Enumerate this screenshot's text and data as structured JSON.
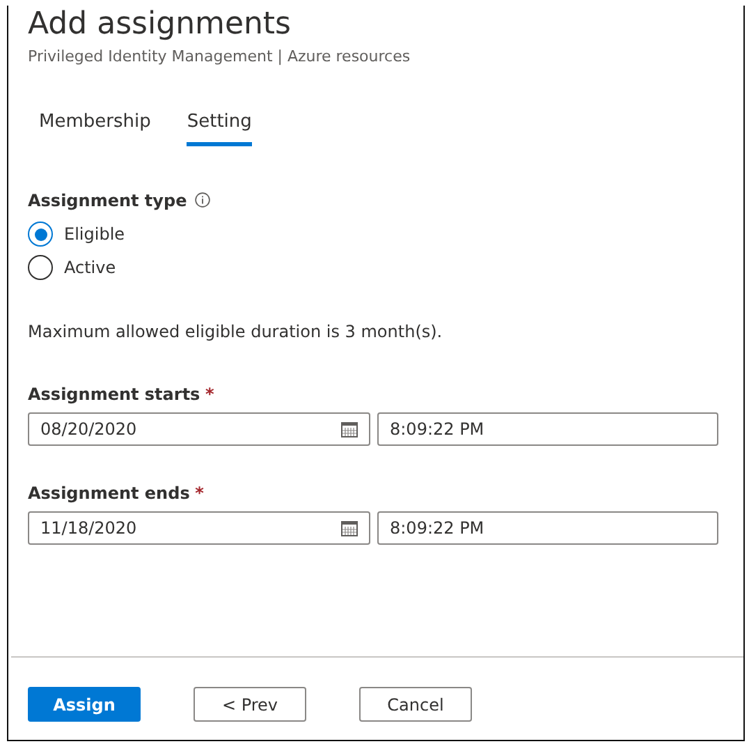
{
  "header": {
    "title": "Add assignments",
    "subtitle": "Privileged Identity Management | Azure resources"
  },
  "tabs": [
    {
      "label": "Membership",
      "selected": false
    },
    {
      "label": "Setting",
      "selected": true
    }
  ],
  "assignment_type": {
    "label": "Assignment type",
    "options": [
      {
        "label": "Eligible",
        "selected": true
      },
      {
        "label": "Active",
        "selected": false
      }
    ]
  },
  "note": "Maximum allowed eligible duration is 3 month(s).",
  "fields": [
    {
      "label": "Assignment starts",
      "required_mark": "*",
      "date": "08/20/2020",
      "time": "8:09:22 PM"
    },
    {
      "label": "Assignment ends",
      "required_mark": "*",
      "date": "11/18/2020",
      "time": "8:09:22 PM"
    }
  ],
  "buttons": [
    {
      "label": "Assign",
      "kind": "primary"
    },
    {
      "label": "< Prev",
      "kind": "default"
    },
    {
      "label": "Cancel",
      "kind": "default"
    }
  ]
}
